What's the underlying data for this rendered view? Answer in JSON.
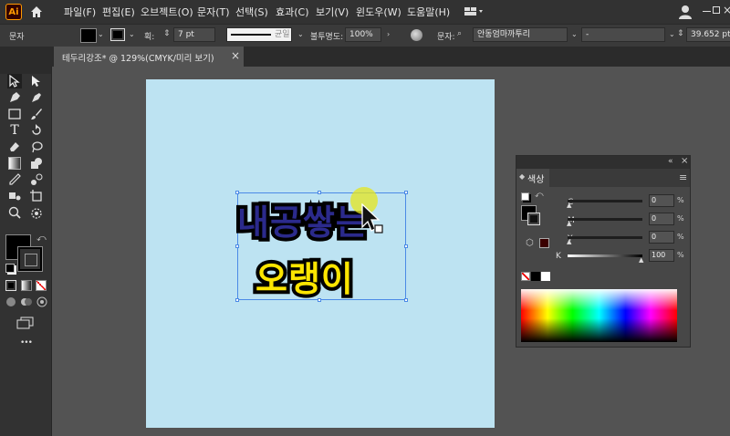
{
  "app": {
    "logo_text": "Ai"
  },
  "menubar": {
    "items": [
      "파일(F)",
      "편집(E)",
      "오브젝트(O)",
      "문자(T)",
      "선택(S)",
      "효과(C)",
      "보기(V)",
      "윈도우(W)",
      "도움말(H)"
    ]
  },
  "controlbar": {
    "mode_label": "문자",
    "stroke_label": "획:",
    "stroke_weight": "7 pt",
    "stroke_style": "균일",
    "opacity_label": "불투명도:",
    "opacity_value": "100%",
    "font_label": "문자:",
    "font_name": "안동엄마까투리",
    "font_style": "-",
    "font_size": "39.652 pt"
  },
  "document": {
    "tab_title": "테두리강조* @ 129%(CMYK/미리 보기)",
    "close_glyph": "×"
  },
  "artwork": {
    "line1": "내공쌓는",
    "line2": "오랭이",
    "colors": {
      "line1_fill": "#2b2a8c",
      "line2_fill": "#fce500",
      "stroke": "#000000",
      "artboard": "#bde3f2"
    }
  },
  "color_panel": {
    "title": "색상",
    "channels": [
      {
        "label": "C",
        "value": "0",
        "unit": "%"
      },
      {
        "label": "M",
        "value": "0",
        "unit": "%"
      },
      {
        "label": "Y",
        "value": "0",
        "unit": "%"
      },
      {
        "label": "K",
        "value": "100",
        "unit": "%"
      }
    ]
  },
  "toolbar": {
    "more_glyph": "•••"
  },
  "icons": [
    "home-icon",
    "workspace-icon",
    "user-icon",
    "minimize-icon",
    "maximize-icon",
    "close-icon",
    "selection-tool-icon",
    "direct-selection-tool-icon",
    "pen-tool-icon",
    "type-tool-icon",
    "eyedropper-tool-icon",
    "zoom-tool-icon",
    "swap-colors-icon",
    "panel-menu-icon"
  ]
}
